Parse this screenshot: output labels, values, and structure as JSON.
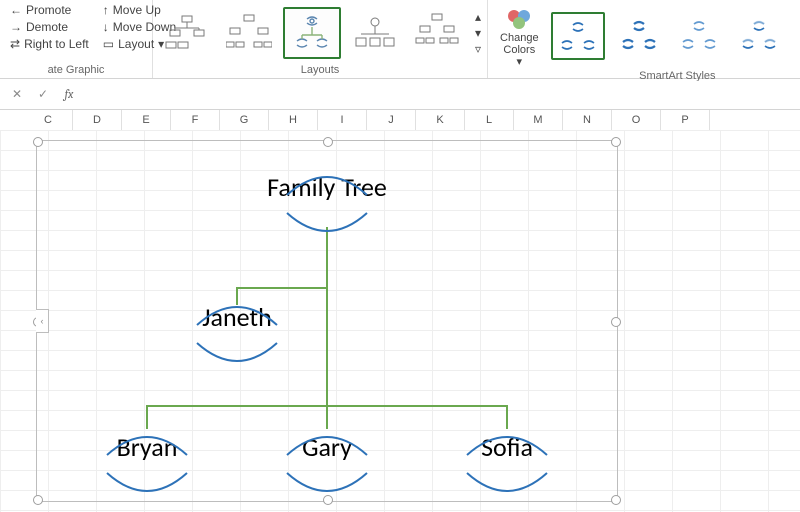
{
  "ribbon": {
    "group_create": {
      "promote": "Promote",
      "demote": "Demote",
      "rtl": "Right to Left",
      "moveup": "Move Up",
      "movedown": "Move Down",
      "layout": "Layout",
      "label": "ate Graphic"
    },
    "group_layouts": {
      "label": "Layouts"
    },
    "change_colors": "Change Colors",
    "group_styles": {
      "label": "SmartArt Styles"
    }
  },
  "formula_bar": {
    "fx": "fx",
    "value": ""
  },
  "columns": [
    "C",
    "D",
    "E",
    "F",
    "G",
    "H",
    "I",
    "J",
    "K",
    "L",
    "M",
    "N",
    "O",
    "P"
  ],
  "smartart": {
    "root": "Family Tree",
    "level1": "Janeth",
    "children": [
      "Bryan",
      "Gary",
      "Sofia"
    ],
    "tab": "‹"
  },
  "chart_data": {
    "type": "table",
    "title": "Family Tree",
    "hierarchy": {
      "name": "Family Tree",
      "children": [
        {
          "name": "Janeth",
          "children": [
            {
              "name": "Bryan"
            },
            {
              "name": "Gary"
            },
            {
              "name": "Sofia"
            }
          ]
        }
      ]
    }
  }
}
